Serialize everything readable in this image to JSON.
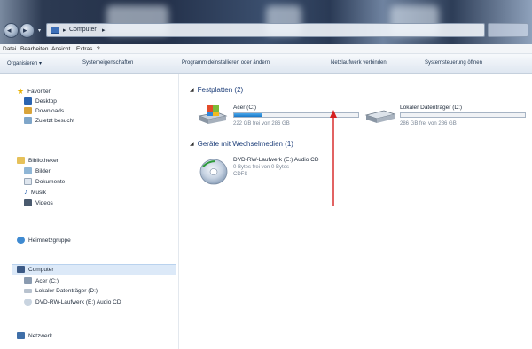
{
  "address": {
    "crumbs": [
      "▸",
      "Computer",
      "▸"
    ]
  },
  "menu": [
    "Datei",
    "Bearbeiten",
    "Ansicht",
    "Extras",
    "?"
  ],
  "commands": [
    "Organisieren ▾",
    "Systemeigenschaften",
    "Programm deinstallieren oder ändern",
    "Netzlaufwerk verbinden",
    "Systemsteuerung öffnen"
  ],
  "nav": {
    "favorites": {
      "label": "Favoriten",
      "items": [
        "Desktop",
        "Downloads",
        "Zuletzt besucht"
      ]
    },
    "libraries": {
      "label": "Bibliotheken",
      "items": [
        "Bilder",
        "Dokumente",
        "Musik",
        "Videos"
      ]
    },
    "homegroup": "Heimnetzgruppe",
    "computer": {
      "label": "Computer",
      "items": [
        "Acer (C:)",
        "Lokaler Datenträger (D:)",
        "DVD-RW-Laufwerk (E:) Audio CD"
      ]
    },
    "network": "Netzwerk"
  },
  "groups": {
    "hdd": {
      "title": "Festplatten (2)"
    },
    "removable": {
      "title": "Geräte mit Wechselmedien (1)"
    }
  },
  "drives": [
    {
      "name": "Acer (C:)",
      "free": "222 GB frei von 286 GB",
      "used_fraction": 0.22
    },
    {
      "name": "Lokaler Datenträger (D:)",
      "free": "286 GB frei von 286 GB",
      "used_fraction": 0.0
    }
  ],
  "dvd": {
    "name": "DVD-RW-Laufwerk (E:) Audio CD",
    "sub1": "0 Bytes frei von 0 Bytes",
    "sub2": "CDFS"
  },
  "colors": {
    "accent": "#1a78c8",
    "annotation": "#d62020",
    "selection": "#dce9f8"
  }
}
